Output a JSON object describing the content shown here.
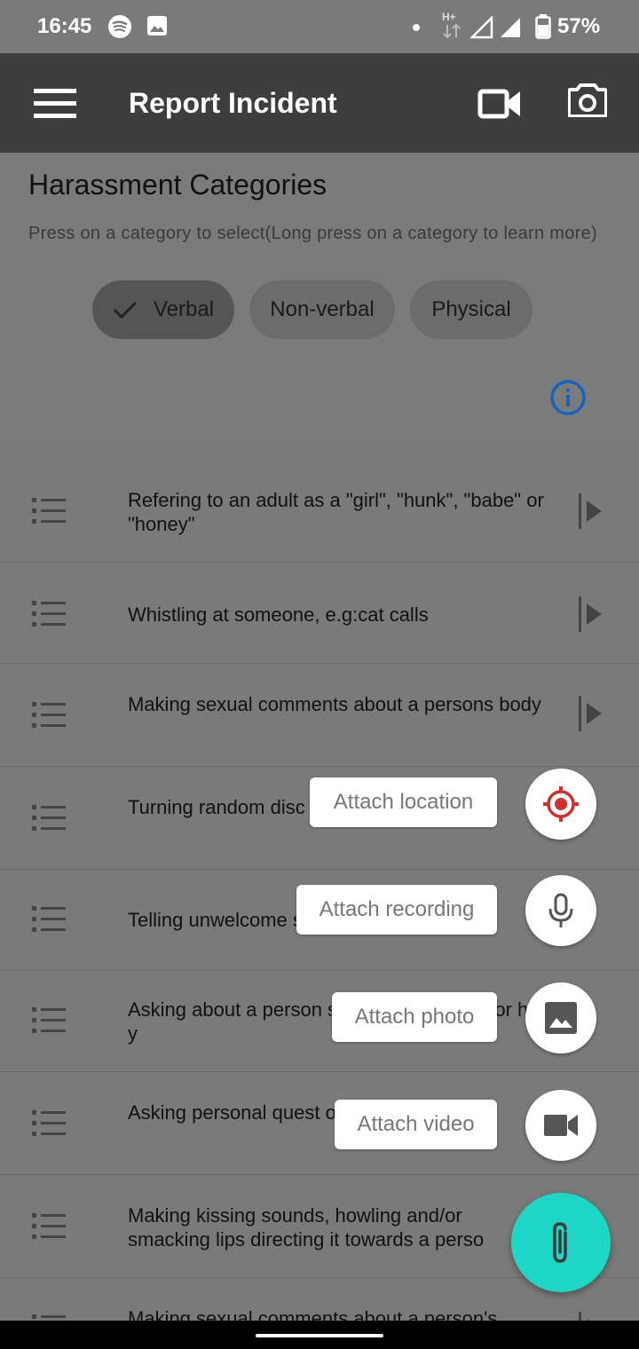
{
  "status_bar": {
    "time": "16:45",
    "battery_percent": "57%",
    "network_label": "H+",
    "icons": [
      "spotify-icon",
      "image-icon",
      "dot-icon",
      "data-arrows-icon",
      "signal-icon",
      "signal-icon",
      "battery-icon"
    ]
  },
  "app_bar": {
    "title": "Report Incident",
    "icons": [
      "menu-icon",
      "videocam-icon",
      "camera-icon"
    ]
  },
  "categories": {
    "title": "Harassment Categories",
    "help": "Press on a category to select(Long press on a category to learn more)",
    "chips": [
      {
        "label": "Verbal",
        "selected": true
      },
      {
        "label": "Non-verbal",
        "selected": false
      },
      {
        "label": "Physical",
        "selected": false
      }
    ]
  },
  "items": [
    {
      "text": "Refering to an adult as a \"girl\", \"hunk\", \"babe\" or \"honey\""
    },
    {
      "text": "Whistling at someone, e.g:cat calls"
    },
    {
      "text": "Making sexual comments about a persons body"
    },
    {
      "text": "Turning random disc topics"
    },
    {
      "text": "Telling unwelcome s"
    },
    {
      "text": "Asking about a person s, preferences and/or his y"
    },
    {
      "text": "Asking personal quest or sexual life"
    },
    {
      "text": "Making kissing sounds, howling and/or smacking lips directing it towards a perso"
    },
    {
      "text": "Making sexual comments about a person's"
    }
  ],
  "fab_menu": {
    "location": "Attach location",
    "recording": "Attach recording",
    "photo": "Attach photo",
    "video": "Attach video"
  },
  "colors": {
    "app_bar": "#3e3e3e",
    "fab": "#1ed6c6",
    "location_accent": "#d32f2f",
    "info_accent": "#1565c0",
    "icon_dark": "#444444"
  }
}
